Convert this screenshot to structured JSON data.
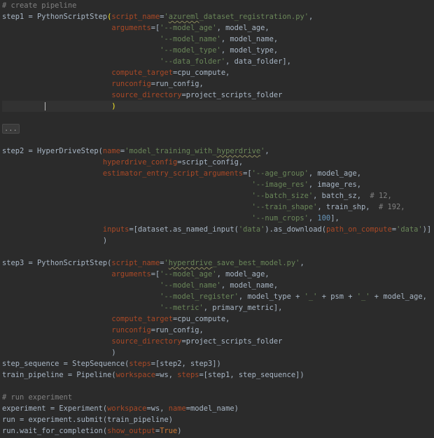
{
  "colors": {
    "background": "#2b2b2b",
    "default_text": "#a9b7c6",
    "comment": "#808080",
    "keyword_argument": "#aa4926",
    "string": "#6a8759",
    "number": "#6897bb",
    "boolean": "#cc7832",
    "matched_paren": "#ffef28",
    "current_line": "#323232"
  },
  "editor": {
    "lines": [
      [
        {
          "t": "# create pipeline",
          "k": "comment"
        }
      ],
      [
        {
          "t": "step1 = PythonScriptStep"
        },
        {
          "t": "(",
          "k": "paren-hl"
        },
        {
          "t": "script_name",
          "k": "kw"
        },
        {
          "t": "="
        },
        {
          "t": "'",
          "k": "str"
        },
        {
          "t": "azureml",
          "k": "str-squig"
        },
        {
          "t": "_dataset_registration.py'",
          "k": "str"
        },
        {
          "t": ","
        }
      ],
      [
        {
          "t": "                         "
        },
        {
          "t": "arguments",
          "k": "kw"
        },
        {
          "t": "=["
        },
        {
          "t": "'--model_age'",
          "k": "str"
        },
        {
          "t": ", model_age,"
        }
      ],
      [
        {
          "t": "                                    "
        },
        {
          "t": "'--model_name'",
          "k": "str"
        },
        {
          "t": ", model_name,"
        }
      ],
      [
        {
          "t": "                                    "
        },
        {
          "t": "'--model_type'",
          "k": "str"
        },
        {
          "t": ", model_type,"
        }
      ],
      [
        {
          "t": "                                    "
        },
        {
          "t": "'--data_folder'",
          "k": "str"
        },
        {
          "t": ", data_folder],"
        }
      ],
      [
        {
          "t": "                         "
        },
        {
          "t": "compute_target",
          "k": "kw"
        },
        {
          "t": "=cpu_compute,"
        }
      ],
      [
        {
          "t": "                         "
        },
        {
          "t": "runconfig",
          "k": "kw"
        },
        {
          "t": "=run_config,"
        }
      ],
      [
        {
          "t": "                         "
        },
        {
          "t": "source_directory",
          "k": "kw"
        },
        {
          "t": "=project_scripts_folder"
        }
      ],
      [
        {
          "t": "                         "
        },
        {
          "t": ")",
          "k": "paren-hl"
        }
      ],
      [],
      [
        {
          "t": "...",
          "k": "fold"
        }
      ],
      [],
      [
        {
          "t": "step2 = HyperDriveStep("
        },
        {
          "t": "name",
          "k": "kw"
        },
        {
          "t": "="
        },
        {
          "t": "'model_training_with_",
          "k": "str"
        },
        {
          "t": "hyperdrive",
          "k": "str-squig"
        },
        {
          "t": "'",
          "k": "str"
        },
        {
          "t": ","
        }
      ],
      [
        {
          "t": "                       "
        },
        {
          "t": "hyperdrive_config",
          "k": "kw"
        },
        {
          "t": "=script_config,"
        }
      ],
      [
        {
          "t": "                       "
        },
        {
          "t": "estimator_entry_script_arguments",
          "k": "kw"
        },
        {
          "t": "=["
        },
        {
          "t": "'--age_group'",
          "k": "str"
        },
        {
          "t": ", model_age,"
        }
      ],
      [
        {
          "t": "                                                         "
        },
        {
          "t": "'--image_res'",
          "k": "str"
        },
        {
          "t": ", image_res,"
        }
      ],
      [
        {
          "t": "                                                         "
        },
        {
          "t": "'--batch_size'",
          "k": "str"
        },
        {
          "t": ", batch_sz,  "
        },
        {
          "t": "# 12,",
          "k": "comment"
        }
      ],
      [
        {
          "t": "                                                         "
        },
        {
          "t": "'--train_shape'",
          "k": "str"
        },
        {
          "t": ", train_shp,  "
        },
        {
          "t": "# 192,",
          "k": "comment"
        }
      ],
      [
        {
          "t": "                                                         "
        },
        {
          "t": "'--num_crops'",
          "k": "str"
        },
        {
          "t": ", "
        },
        {
          "t": "100",
          "k": "num"
        },
        {
          "t": "],"
        }
      ],
      [
        {
          "t": "                       "
        },
        {
          "t": "inputs",
          "k": "kw"
        },
        {
          "t": "=[dataset.as_named_input("
        },
        {
          "t": "'data'",
          "k": "str"
        },
        {
          "t": ").as_download("
        },
        {
          "t": "path_on_compute",
          "k": "kw"
        },
        {
          "t": "="
        },
        {
          "t": "'data'",
          "k": "str"
        },
        {
          "t": ")]"
        }
      ],
      [
        {
          "t": "                       )"
        }
      ],
      [],
      [
        {
          "t": "step3 = PythonScriptStep("
        },
        {
          "t": "script_name",
          "k": "kw"
        },
        {
          "t": "="
        },
        {
          "t": "'",
          "k": "str"
        },
        {
          "t": "hyperdrive",
          "k": "str-squig"
        },
        {
          "t": "_save_best_model.py'",
          "k": "str"
        },
        {
          "t": ","
        }
      ],
      [
        {
          "t": "                         "
        },
        {
          "t": "arguments",
          "k": "kw"
        },
        {
          "t": "=["
        },
        {
          "t": "'--model_age'",
          "k": "str"
        },
        {
          "t": ", model_age,"
        }
      ],
      [
        {
          "t": "                                    "
        },
        {
          "t": "'--model_name'",
          "k": "str"
        },
        {
          "t": ", model_name,"
        }
      ],
      [
        {
          "t": "                                    "
        },
        {
          "t": "'--model_register'",
          "k": "str"
        },
        {
          "t": ", model_type + "
        },
        {
          "t": "'_'",
          "k": "str"
        },
        {
          "t": " + psm + "
        },
        {
          "t": "'_'",
          "k": "str"
        },
        {
          "t": " + model_age,"
        }
      ],
      [
        {
          "t": "                                    "
        },
        {
          "t": "'--metric'",
          "k": "str"
        },
        {
          "t": ", primary_metric],"
        }
      ],
      [
        {
          "t": "                         "
        },
        {
          "t": "compute_target",
          "k": "kw"
        },
        {
          "t": "=cpu_compute,"
        }
      ],
      [
        {
          "t": "                         "
        },
        {
          "t": "runconfig",
          "k": "kw"
        },
        {
          "t": "=run_config,"
        }
      ],
      [
        {
          "t": "                         "
        },
        {
          "t": "source_directory",
          "k": "kw"
        },
        {
          "t": "=project_scripts_folder"
        }
      ],
      [
        {
          "t": "                         )"
        }
      ],
      [
        {
          "t": "step_sequence = StepSequence("
        },
        {
          "t": "steps",
          "k": "kw"
        },
        {
          "t": "=[step2, step3])"
        }
      ],
      [
        {
          "t": "train_pipeline = Pipeline("
        },
        {
          "t": "workspace",
          "k": "kw"
        },
        {
          "t": "=ws, "
        },
        {
          "t": "steps",
          "k": "kw"
        },
        {
          "t": "=[step1, step_sequence])"
        }
      ],
      [],
      [
        {
          "t": "# run experiment",
          "k": "comment"
        }
      ],
      [
        {
          "t": "experiment = Experiment("
        },
        {
          "t": "workspace",
          "k": "kw"
        },
        {
          "t": "=ws, "
        },
        {
          "t": "name",
          "k": "kw"
        },
        {
          "t": "=model_name)"
        }
      ],
      [
        {
          "t": "run = experiment.submit(train_pipeline)"
        }
      ],
      [
        {
          "t": "run.wait_for_completion("
        },
        {
          "t": "show_output",
          "k": "kw"
        },
        {
          "t": "="
        },
        {
          "t": "True",
          "k": "bool"
        },
        {
          "t": ")"
        }
      ]
    ]
  }
}
